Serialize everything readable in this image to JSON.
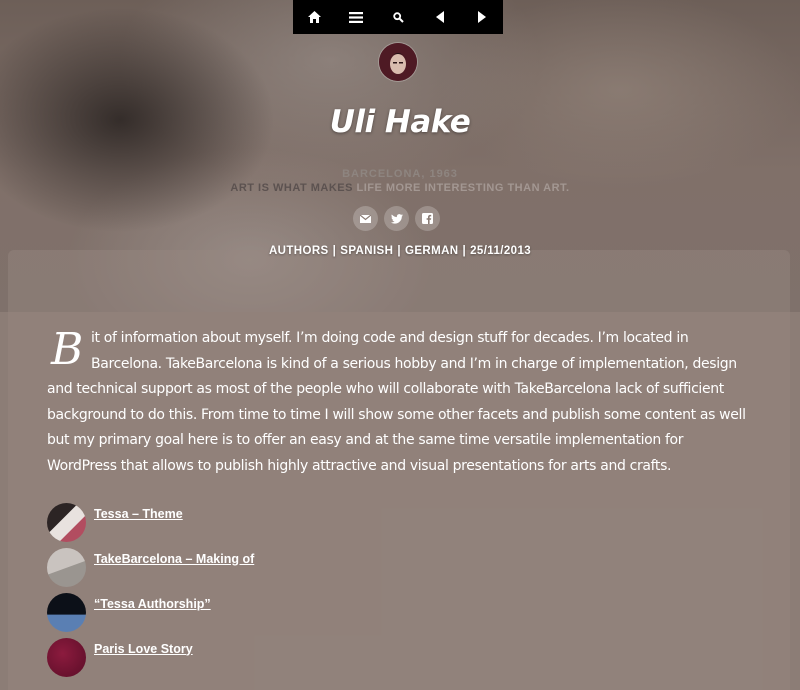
{
  "nav": {
    "buttons": [
      {
        "name": "home",
        "icon": "home-icon"
      },
      {
        "name": "menu",
        "icon": "menu-icon"
      },
      {
        "name": "search",
        "icon": "search-icon"
      },
      {
        "name": "previous",
        "icon": "triangle-left-icon"
      },
      {
        "name": "next",
        "icon": "triangle-right-icon"
      }
    ]
  },
  "author": {
    "name": "Uli Hake",
    "bio_line1": "BARCELONA, 1963",
    "bio_line2_strong": "ART IS WHAT MAKES",
    "bio_line2_rest": " LIFE MORE INTERESTING THAN ART.",
    "social": [
      {
        "name": "email",
        "icon": "mail-icon"
      },
      {
        "name": "twitter",
        "icon": "twitter-icon"
      },
      {
        "name": "facebook",
        "icon": "facebook-icon"
      }
    ]
  },
  "meta": {
    "category": "AUTHORS",
    "lang1": "SPANISH",
    "lang2": "GERMAN",
    "date": "25/11/2013"
  },
  "article": {
    "dropcap": "B",
    "text": "it of information about myself. I’m doing code and design stuff for decades. I’m located in Barcelona. TakeBarcelona is kind of a serious hobby and I’m in charge of implementation, design and technical support as most of the people who will collaborate with TakeBarcelona lack of sufficient background to do this. From time to time I will show some other facets and publish some content as well but my primary goal here is to offer an easy and at the same time versatile implementation for WordPress that allows to publish highly attractive and visual presentations for arts and crafts."
  },
  "related": [
    {
      "title": "Tessa – Theme"
    },
    {
      "title": "TakeBarcelona – Making of"
    },
    {
      "title": "“Tessa Authorship”"
    },
    {
      "title": "Paris Love Story"
    }
  ],
  "colors": {
    "background": "#8c7d76",
    "topbar": "#000000",
    "text": "#ffffff"
  }
}
